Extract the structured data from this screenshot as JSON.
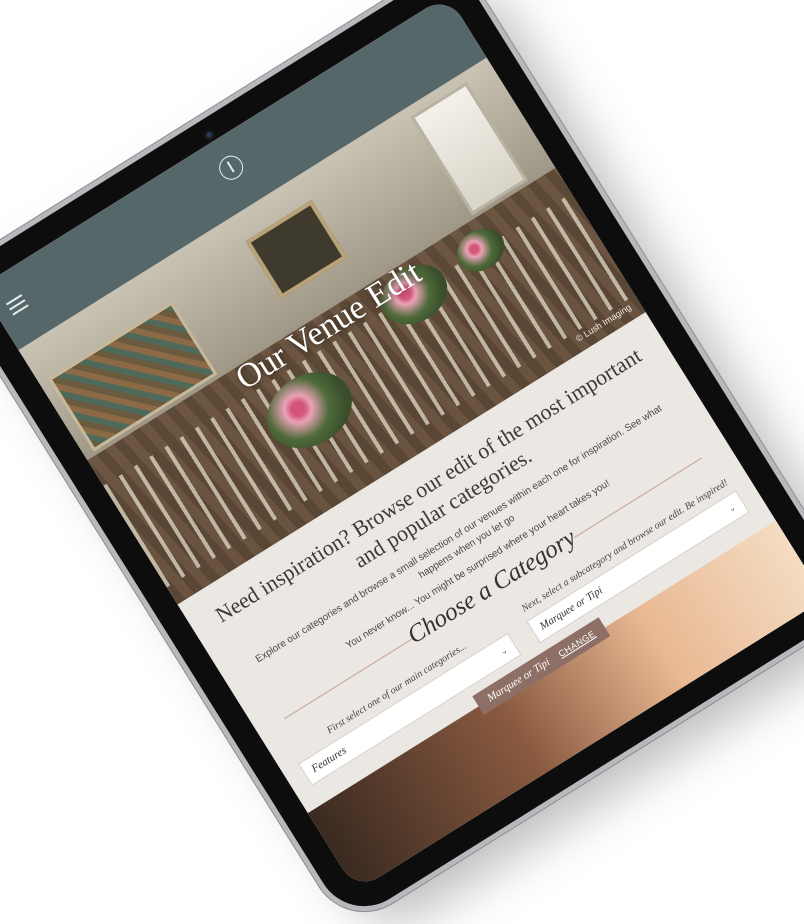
{
  "hero": {
    "title": "Our Venue Edit",
    "credit": "© Lush Imaging"
  },
  "intro": {
    "heading": "Need inspiration? Browse our edit of the most important and popular categories.",
    "text1": "Explore our categories and browse a small selection of our venues within each one for inspiration. See what happens when you let go",
    "text2": "You never know... You might be surprised where your heart takes you!"
  },
  "category": {
    "title": "Choose a Category",
    "main_label": "First select one of our main categories...",
    "main_value": "Features",
    "sub_label": "Next, select a subcategory and browse our edit. Be inspired!",
    "sub_value": "Marquee or Tipi"
  },
  "chip": {
    "label": "Marquee or Tipi",
    "action": "CHANGE"
  },
  "colors": {
    "topbar": "#56676a",
    "accent": "#8e6f66",
    "page_bg": "#ebe7e2"
  }
}
